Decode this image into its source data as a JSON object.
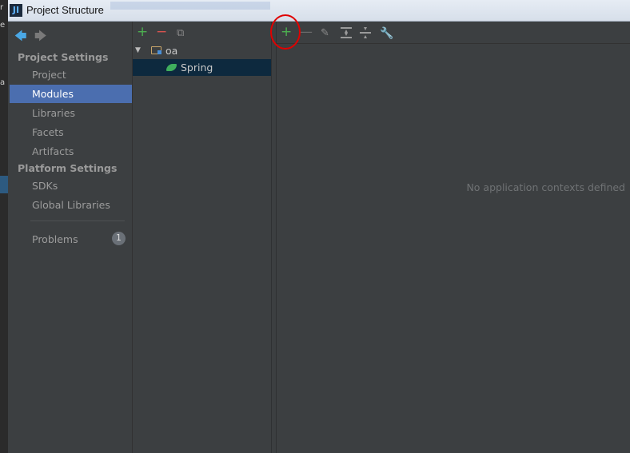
{
  "window": {
    "title": "Project Structure",
    "icon_text": "JI"
  },
  "desktop_edge": {
    "lines": [
      "r",
      "e",
      "a"
    ]
  },
  "navigation": {
    "back_icon": "arrow-left-icon",
    "forward_icon": "arrow-right-icon"
  },
  "sidebar": {
    "project_settings_heading": "Project Settings",
    "project_items": [
      "Project",
      "Modules",
      "Libraries",
      "Facets",
      "Artifacts"
    ],
    "platform_settings_heading": "Platform Settings",
    "platform_items": [
      "SDKs",
      "Global Libraries"
    ],
    "problems_label": "Problems",
    "problems_count": "1",
    "selected": "Modules"
  },
  "module_tree": {
    "toolbar": {
      "add": "+",
      "remove": "−"
    },
    "root": {
      "label": "oa",
      "expanded": true
    },
    "child": {
      "label": "Spring",
      "selected": true
    }
  },
  "main": {
    "toolbar": {
      "add": "+",
      "remove": "—"
    },
    "empty_message": "No application contexts defined"
  },
  "colors": {
    "background": "#3c3f41",
    "selection": "#4b6eaf",
    "tree_selection": "#0d293e",
    "add_green": "#4caf50",
    "remove_red": "#d9534f",
    "highlight_ring": "#e00000"
  }
}
